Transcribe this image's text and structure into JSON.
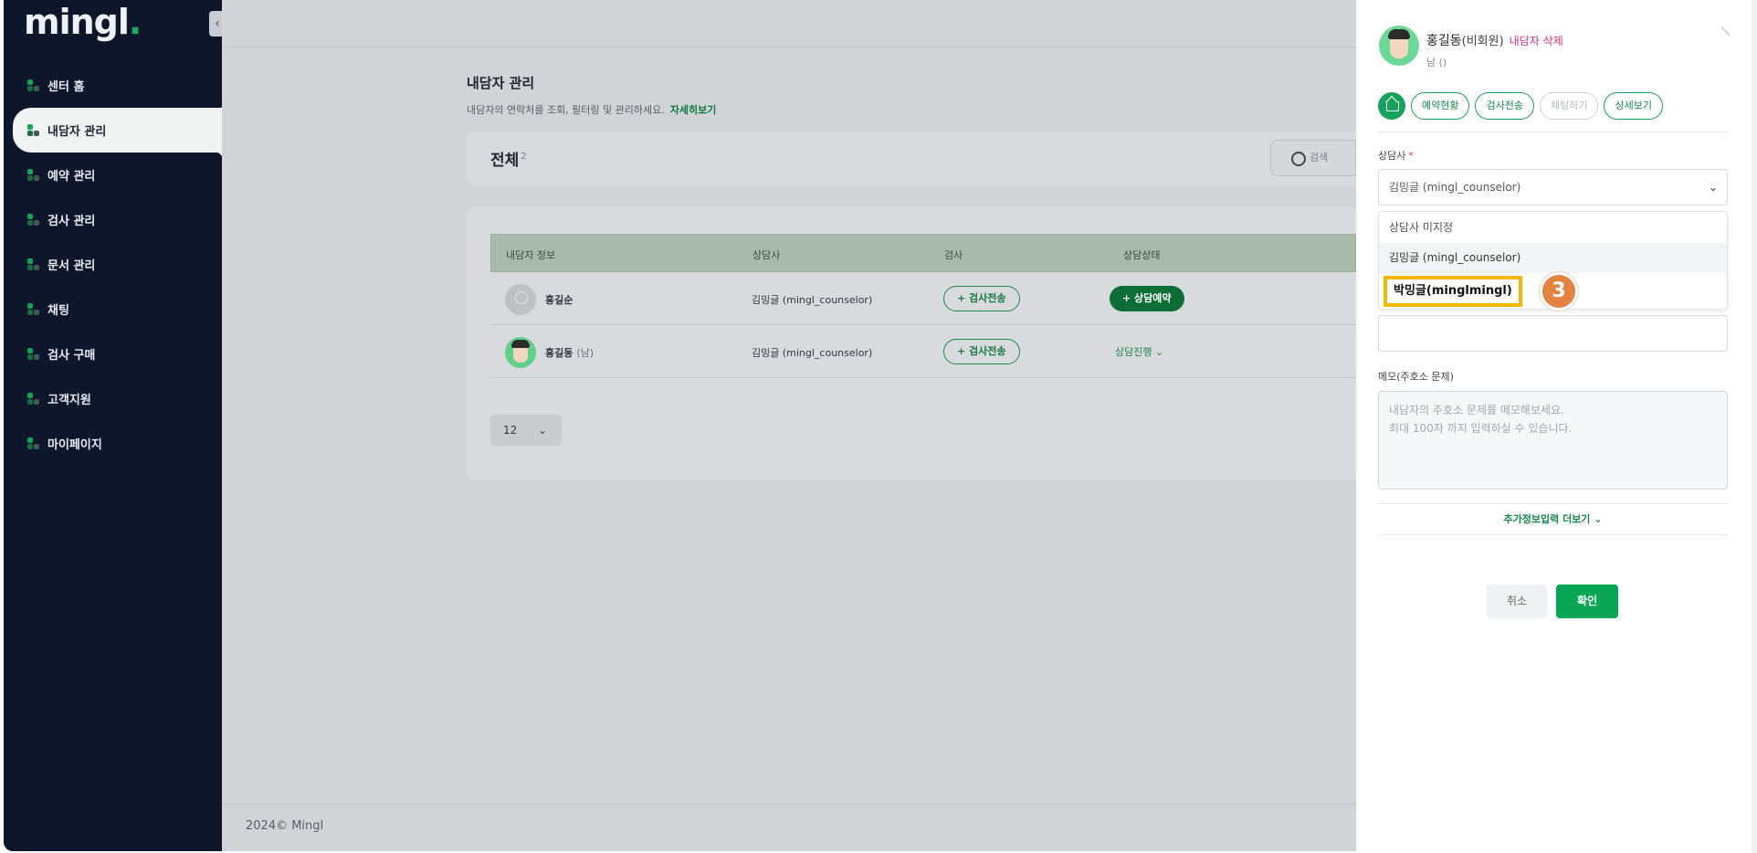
{
  "app": {
    "logo": "mingl",
    "logo_dot": "."
  },
  "sidebar": {
    "items": [
      {
        "label": "센터 홈"
      },
      {
        "label": "내담자 관리"
      },
      {
        "label": "예약 관리"
      },
      {
        "label": "검사 관리"
      },
      {
        "label": "문서 관리"
      },
      {
        "label": "채팅"
      },
      {
        "label": "검사 구매"
      },
      {
        "label": "고객지원"
      },
      {
        "label": "마이페이지"
      }
    ],
    "collapse_icon": "‹"
  },
  "page": {
    "title": "내담자 관리",
    "desc": "내담자의 연락처를 조회, 필터링 및 관리하세요.",
    "more_link": "자세히보기",
    "section_title": "전체",
    "section_count": "2",
    "search_placeholder": "검색"
  },
  "table": {
    "headers": [
      "내담자 정보",
      "상담사",
      "검사",
      "상담상태"
    ],
    "rows": [
      {
        "name": "홍길순",
        "gender": "",
        "counselor": "김밍글 (mingl_counselor)",
        "test_button": "+ 검사전송",
        "status_button": "+ 상담예약",
        "status_text": ""
      },
      {
        "name": "홍길동",
        "gender": "(남)",
        "counselor": "김밍글 (mingl_counselor)",
        "test_button": "+ 검사전송",
        "status_button": "",
        "status_text": "상담진행"
      }
    ],
    "page_size": "12",
    "chev": "⌄"
  },
  "footer": {
    "copyright": "2024© Mingl"
  },
  "panel": {
    "name": "홍길동",
    "role": "(비회원)",
    "delete_label": "내담자 삭제",
    "sub": "남 ()",
    "tabs": [
      "예약현황",
      "검사전송",
      "채팅하기",
      "상세보기"
    ],
    "counselor_label": "상담사",
    "required_mark": "*",
    "counselor_value": "김밍글 (mingl_counselor)",
    "select_chev": "⌄",
    "dropdown_options": [
      "상담사 미지정",
      "김밍글 (mingl_counselor)",
      "박밍글(minglmingl)"
    ],
    "step_badge": "3",
    "memo_label": "메모(주호소 문제)",
    "memo_placeholder": "내담자의 주호소 문제를 메모해보세요.\n최대 100자 까지 입력하실 수 있습니다.",
    "more_info": "추가정보입력 더보기 ⌄",
    "cancel": "취소",
    "confirm": "확인"
  },
  "colors": {
    "sidebar_bg": "#0e162b",
    "accent_green": "#09a655",
    "delete_pink": "#e0336b",
    "highlight_yellow": "#f5b800",
    "badge_orange": "#e4823f"
  }
}
